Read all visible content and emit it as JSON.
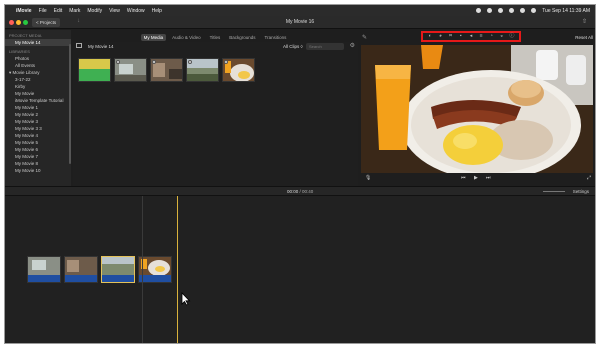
{
  "menubar": {
    "app": "iMovie",
    "items": [
      "File",
      "Edit",
      "Mark",
      "Modify",
      "View",
      "Window",
      "Help"
    ],
    "clock": "Tue Sep 14 11:39 AM"
  },
  "titlebar": {
    "projects_label": "< Projects",
    "title": "My Movie 16"
  },
  "browser_tabs": [
    "My Media",
    "Audio & Video",
    "Titles",
    "Backgrounds",
    "Transitions"
  ],
  "sidebar": {
    "project_media_head": "PROJECT MEDIA",
    "project_item": "My Movie 14",
    "libraries_head": "LIBRARIES",
    "library_items": [
      "Photos",
      "All Events"
    ],
    "movie_library": "Movie Library",
    "events": [
      "3-17-22",
      "Kirby",
      "My Movie",
      "iMovie Template Tutorial",
      "My Movie 1",
      "My Movie 2",
      "My Movie 3",
      "My Movie 3 3",
      "My Movie 4",
      "My Movie 5",
      "My Movie 6",
      "My Movie 7",
      "My Movie 8",
      "My Movie 10"
    ]
  },
  "browser": {
    "title": "My Movie 14",
    "filter": "All Clips ◊",
    "search_placeholder": "Search"
  },
  "viewer": {
    "reset_all": "Reset All"
  },
  "timeline": {
    "current_time": "00:00",
    "duration": "/ 00:40",
    "settings": "Settings"
  }
}
